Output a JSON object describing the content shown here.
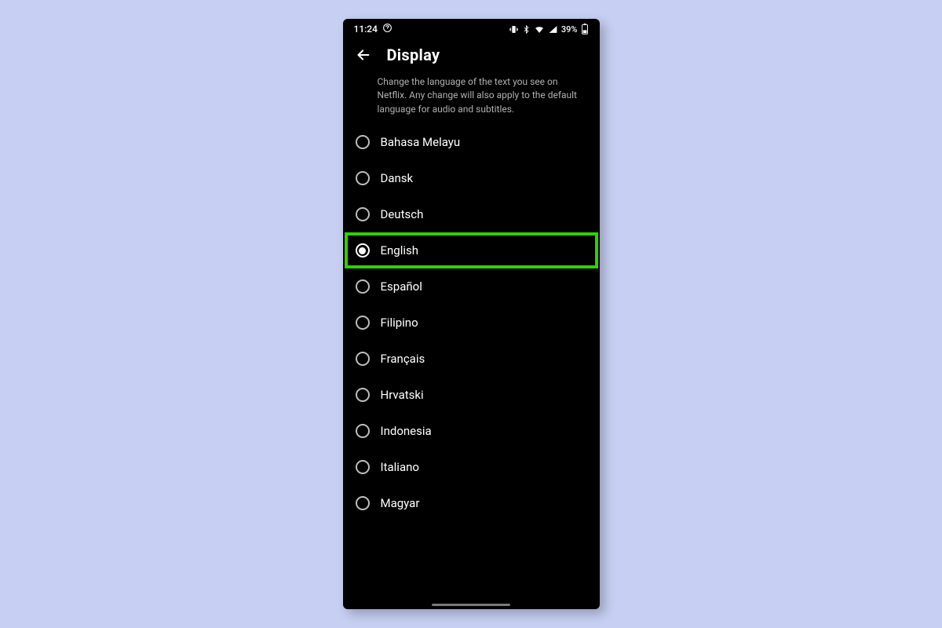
{
  "statusbar": {
    "time": "11:24",
    "battery_pct": "39%"
  },
  "header": {
    "title": "Display"
  },
  "description": "Change the language of the text you see on Netflix. Any change will also apply to the default language for audio and subtitles.",
  "languages": [
    {
      "label": "Bahasa Melayu",
      "selected": false
    },
    {
      "label": "Dansk",
      "selected": false
    },
    {
      "label": "Deutsch",
      "selected": false
    },
    {
      "label": "English",
      "selected": true,
      "highlight": true
    },
    {
      "label": "Español",
      "selected": false
    },
    {
      "label": "Filipino",
      "selected": false
    },
    {
      "label": "Français",
      "selected": false
    },
    {
      "label": "Hrvatski",
      "selected": false
    },
    {
      "label": "Indonesia",
      "selected": false
    },
    {
      "label": "Italiano",
      "selected": false
    },
    {
      "label": "Magyar",
      "selected": false
    }
  ],
  "colors": {
    "highlight": "#30d000",
    "page_bg": "#c7cff2",
    "phone_bg": "#000000"
  }
}
